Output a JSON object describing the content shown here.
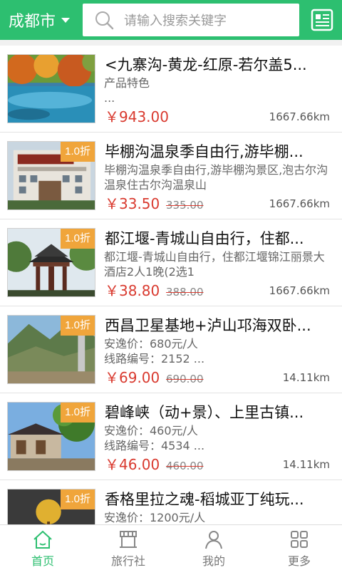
{
  "header": {
    "city": "成都市",
    "search_placeholder": "请输入搜索关键字"
  },
  "colors": {
    "brand_green": "#2dbf70",
    "price_red": "#d93a2f",
    "discount_orange": "#f0a53b"
  },
  "items": [
    {
      "title": "<九寨沟-黄龙-红原-若尔盖5...",
      "desc": "产品特色\n...",
      "price": "￥943.00",
      "old_price": "",
      "distance": "1667.66km",
      "badge": "",
      "image": "autumn-lake-thumbnail"
    },
    {
      "title": "毕棚沟温泉季自由行,游毕棚...",
      "desc": "毕棚沟温泉季自由行,游毕棚沟景区,泡古尔沟温泉住古尔沟温泉山",
      "price": "￥33.50",
      "old_price": "335.00",
      "distance": "1667.66km",
      "badge": "1.0折",
      "image": "hotel-building-thumbnail"
    },
    {
      "title": "都江堰-青城山自由行，住都...",
      "desc": "都江堰-青城山自由行，住都江堰锦江丽景大酒店2人1晚(2选1",
      "price": "￥38.80",
      "old_price": "388.00",
      "distance": "1667.66km",
      "badge": "1.0折",
      "image": "pavilion-thumbnail"
    },
    {
      "title": "西昌卫星基地+泸山邛海双卧...",
      "desc": "安逸价：680元/人\n线路编号：2152 ...",
      "price": "￥69.00",
      "old_price": "690.00",
      "distance": "14.11km",
      "badge": "1.0折",
      "image": "mountain-valley-thumbnail"
    },
    {
      "title": "碧峰峡（动+景）、上里古镇...",
      "desc": "安逸价：460元/人\n线路编号：4534 ...",
      "price": "￥46.00",
      "old_price": "460.00",
      "distance": "14.11km",
      "badge": "1.0折",
      "image": "ancient-town-thumbnail"
    },
    {
      "title": "香格里拉之魂-稻城亚丁纯玩...",
      "desc": "安逸价：1200元/人",
      "price": "",
      "old_price": "",
      "distance": "",
      "badge": "1.0折",
      "image": "yellow-tree-thumbnail"
    }
  ],
  "tabs": [
    {
      "label": "首页",
      "icon": "home-icon",
      "active": true
    },
    {
      "label": "旅行社",
      "icon": "shop-icon",
      "active": false
    },
    {
      "label": "我的",
      "icon": "user-icon",
      "active": false
    },
    {
      "label": "更多",
      "icon": "grid-icon",
      "active": false
    }
  ]
}
